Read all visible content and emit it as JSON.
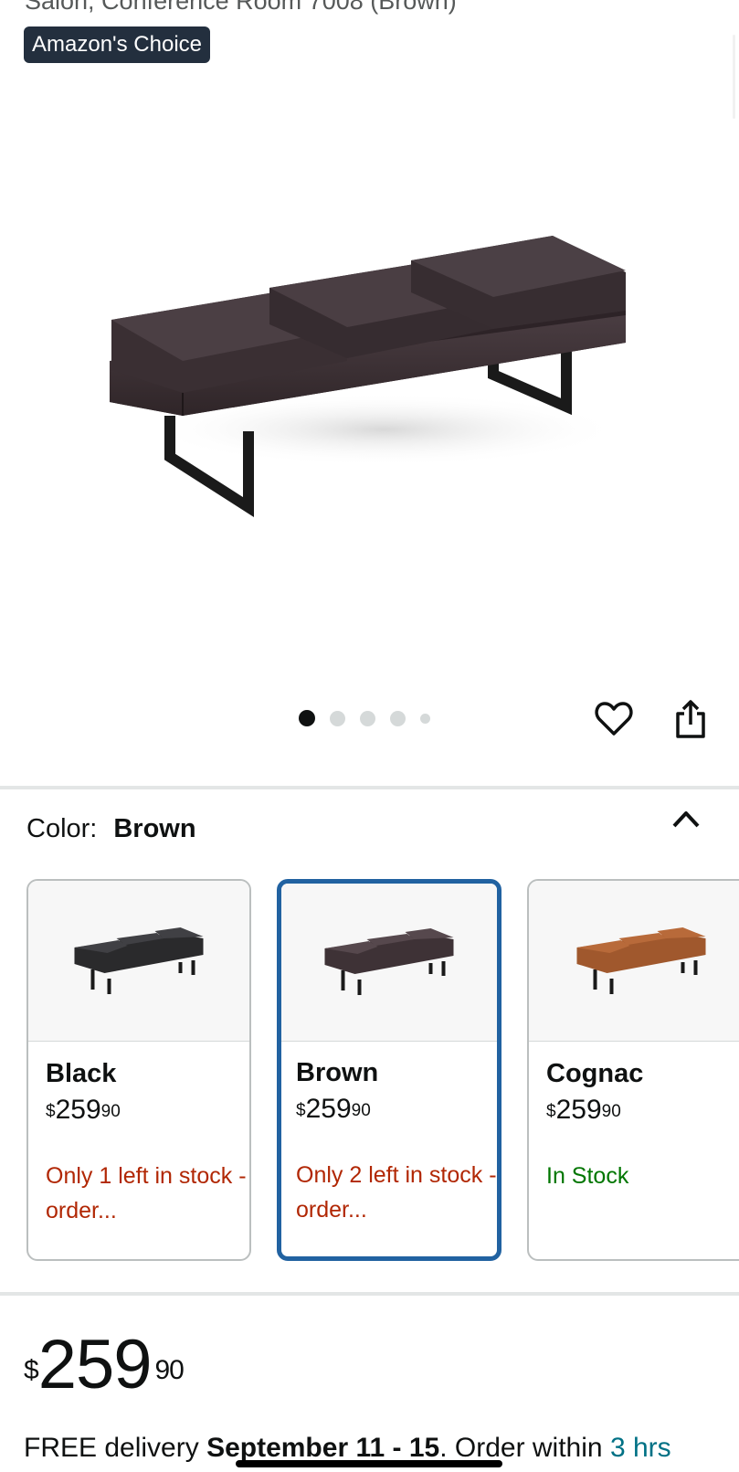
{
  "product": {
    "title_fragment": "Salon, Conference Room 7008 (Brown)",
    "badge": "Amazon's Choice"
  },
  "gallery": {
    "image_count": 5,
    "active_index": 0
  },
  "actions": {
    "favorite_icon": "heart-icon",
    "share_icon": "share-icon"
  },
  "color_selector": {
    "label": "Color:",
    "selected": "Brown",
    "options": [
      {
        "name": "Black",
        "currency": "$",
        "price_whole": "259",
        "price_cents": "90",
        "stock": "Only 1 left in stock - order...",
        "swatch": "#2a2a2c"
      },
      {
        "name": "Brown",
        "currency": "$",
        "price_whole": "259",
        "price_cents": "90",
        "stock": "Only 2 left in stock - order...",
        "swatch": "#3e3236"
      },
      {
        "name": "Cognac",
        "currency": "$",
        "price_whole": "259",
        "price_cents": "90",
        "stock": "In Stock",
        "swatch": "#a0582d"
      }
    ]
  },
  "price": {
    "currency": "$",
    "whole": "259",
    "cents": "90"
  },
  "delivery": {
    "prefix": "FREE delivery ",
    "date": "September 11 - 15",
    "order_within": ". Order within ",
    "time_left": "3 hrs"
  },
  "colors": {
    "badge_bg": "#232f3e",
    "selected_border": "#2162a1",
    "low_stock": "#b12704",
    "in_stock": "#007600",
    "link_teal": "#007185"
  }
}
